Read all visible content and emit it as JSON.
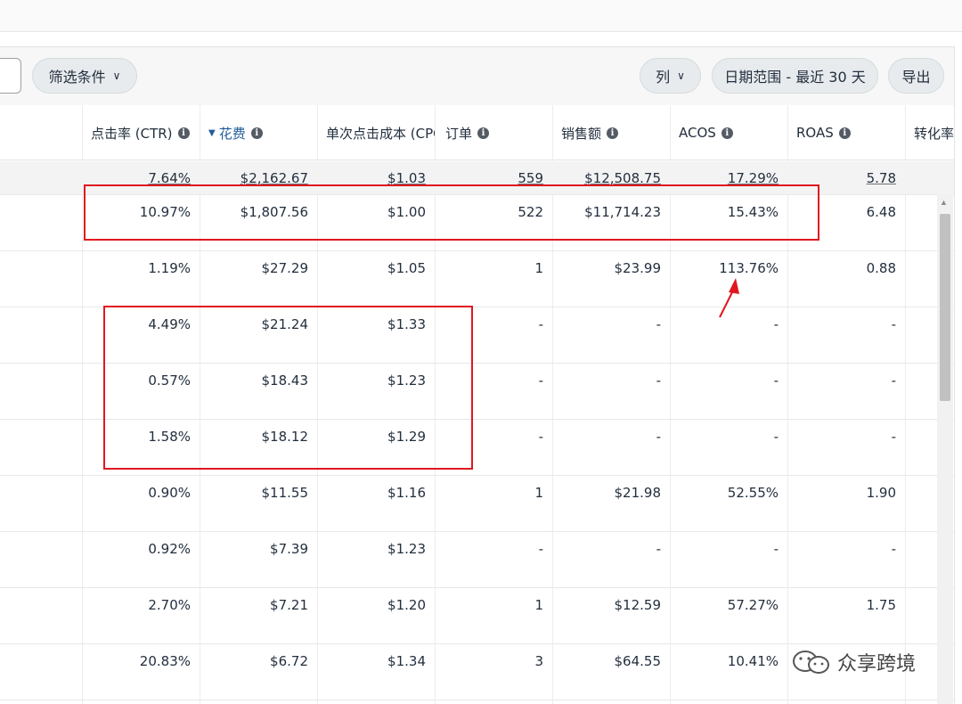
{
  "toolbar": {
    "filter_label": "筛选条件",
    "columns_label": "列",
    "date_range_label": "日期范围 - 最近 30 天",
    "export_label": "导出"
  },
  "columns": {
    "ctr": "点击率 (CTR)",
    "spend": "花费",
    "cpc": "单次点击成本 (CPC",
    "orders": "订单",
    "sales": "销售额",
    "acos": "ACOS",
    "roas": "ROAS",
    "cvr": "转化率"
  },
  "summary": {
    "ctr": "7.64%",
    "spend": "$2,162.67",
    "cpc": "$1.03",
    "orders": "559",
    "sales": "$12,508.75",
    "acos": "17.29%",
    "roas": "5.78"
  },
  "rows": [
    {
      "ctr": "10.97%",
      "spend": "$1,807.56",
      "cpc": "$1.00",
      "orders": "522",
      "sales": "$11,714.23",
      "acos": "15.43%",
      "roas": "6.48"
    },
    {
      "ctr": "1.19%",
      "spend": "$27.29",
      "cpc": "$1.05",
      "orders": "1",
      "sales": "$23.99",
      "acos": "113.76%",
      "roas": "0.88"
    },
    {
      "ctr": "4.49%",
      "spend": "$21.24",
      "cpc": "$1.33",
      "orders": "-",
      "sales": "-",
      "acos": "-",
      "roas": "-"
    },
    {
      "ctr": "0.57%",
      "spend": "$18.43",
      "cpc": "$1.23",
      "orders": "-",
      "sales": "-",
      "acos": "-",
      "roas": "-"
    },
    {
      "ctr": "1.58%",
      "spend": "$18.12",
      "cpc": "$1.29",
      "orders": "-",
      "sales": "-",
      "acos": "-",
      "roas": "-"
    },
    {
      "ctr": "0.90%",
      "spend": "$11.55",
      "cpc": "$1.16",
      "orders": "1",
      "sales": "$21.98",
      "acos": "52.55%",
      "roas": "1.90"
    },
    {
      "ctr": "0.92%",
      "spend": "$7.39",
      "cpc": "$1.23",
      "orders": "-",
      "sales": "-",
      "acos": "-",
      "roas": "-"
    },
    {
      "ctr": "2.70%",
      "spend": "$7.21",
      "cpc": "$1.20",
      "orders": "1",
      "sales": "$12.59",
      "acos": "57.27%",
      "roas": "1.75"
    },
    {
      "ctr": "20.83%",
      "spend": "$6.72",
      "cpc": "$1.34",
      "orders": "3",
      "sales": "$64.55",
      "acos": "10.41%",
      "roas": ""
    }
  ],
  "watermark": {
    "text": "众享跨境"
  },
  "colors": {
    "highlight": "#e0171f",
    "active_sort": "#1f5c99"
  },
  "icons": {
    "info": "info-icon",
    "dropdown": "chevron-down-icon",
    "sort": "sort-desc-icon",
    "watermark": "wechat-icon"
  }
}
